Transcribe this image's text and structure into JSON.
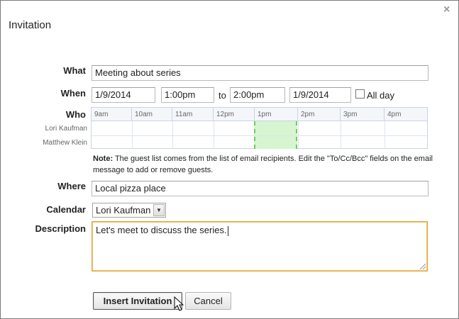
{
  "dialog": {
    "title": "Invitation",
    "close_symbol": "×"
  },
  "form": {
    "what_label": "What",
    "what_value": "Meeting about series",
    "when_label": "When",
    "start_date": "1/9/2014",
    "start_time": "1:00pm",
    "to_label": "to",
    "end_time": "2:00pm",
    "end_date": "1/9/2014",
    "all_day_label": "All day",
    "all_day_checked": false,
    "who_label": "Who",
    "where_label": "Where",
    "where_value": "Local pizza place",
    "calendar_label": "Calendar",
    "calendar_value": "Lori Kaufman",
    "description_label": "Description",
    "description_value": "Let's meet to discuss the series."
  },
  "scheduler": {
    "hours": [
      "9am",
      "10am",
      "11am",
      "12pm",
      "1pm",
      "2pm",
      "3pm",
      "4pm"
    ],
    "guests": [
      "Lori Kaufman",
      "Matthew Klein"
    ],
    "selected_slot": "1pm",
    "selected_color": "#d6f5d0"
  },
  "note": {
    "prefix": "Note:",
    "text": " The guest list comes from the list of email recipients. Edit the \"To/Cc/Bcc\" fields on the email message to add or remove guests."
  },
  "buttons": {
    "insert": "Insert Invitation",
    "cancel": "Cancel"
  },
  "colors": {
    "focus_border": "#e2a33a",
    "grid_border": "#c8d4e6"
  }
}
